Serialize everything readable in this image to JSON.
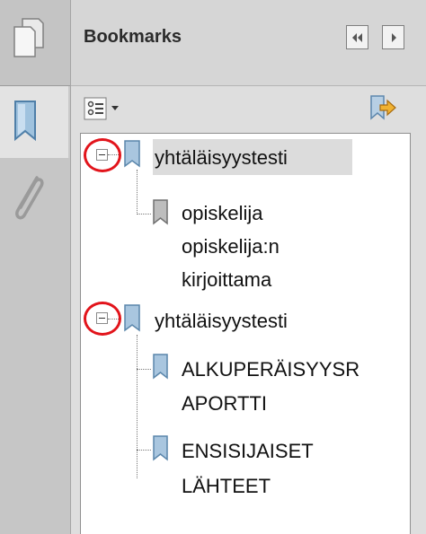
{
  "panel": {
    "title": "Bookmarks"
  },
  "bookmarks": [
    {
      "label": "yhtäläisyystesti",
      "expanded": true,
      "selected": true,
      "children": [
        {
          "lines": [
            "opiskelija",
            "opiskelija:n",
            "kirjoittama"
          ]
        }
      ]
    },
    {
      "label": "yhtäläisyystesti",
      "expanded": true,
      "selected": false,
      "children": [
        {
          "lines": [
            "ALKUPERÄISYYSR",
            "APORTTI"
          ]
        },
        {
          "lines": [
            "ENSISIJAISET",
            "LÄHTEET"
          ]
        }
      ]
    }
  ],
  "icons": {
    "pages": "pages-icon",
    "bookmarks_tab": "bookmark-ribbon-icon",
    "attachments": "paperclip-icon",
    "options": "options-menu-icon",
    "new_bookmark": "new-bookmark-icon",
    "collapse_panel": "double-chevron-left-icon",
    "expand_panel": "chevron-right-icon"
  },
  "colors": {
    "highlight_circle": "#e2141b",
    "bookmark_icon": "#7ea7c9",
    "selected_row": "#dcdcdc"
  }
}
